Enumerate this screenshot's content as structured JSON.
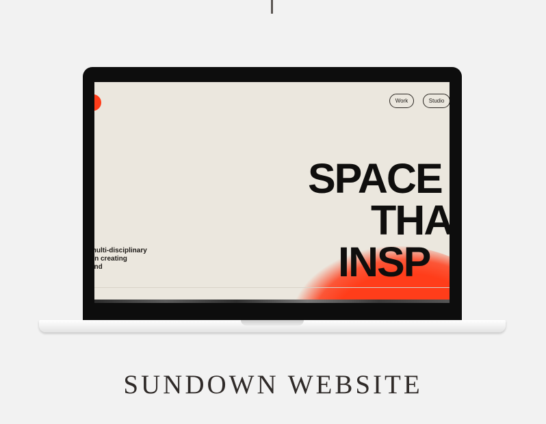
{
  "caption": "SUNDOWN WEBSITE",
  "website": {
    "nav": {
      "work_label": "Work",
      "studio_label": "Studio"
    },
    "hero": {
      "line1": "SPACE",
      "line2": "THA",
      "line3": "INSP"
    },
    "intro_lines": [
      "multi-disciplinary",
      "on creating",
      "end",
      "d"
    ]
  },
  "colors": {
    "accent": "#ff3d1a",
    "page_bg": "#ebe7de",
    "text": "#0f0e0d"
  }
}
